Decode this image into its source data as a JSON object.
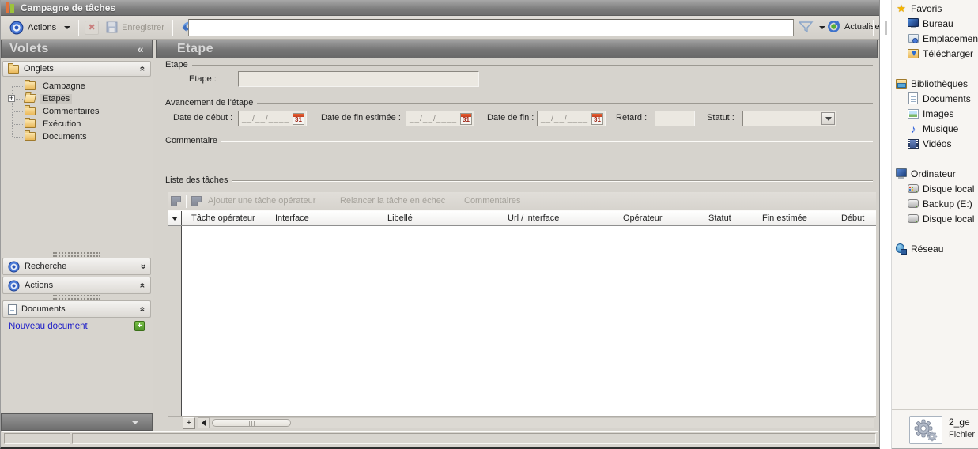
{
  "window": {
    "title": "Campagne de tâches",
    "toolbar": {
      "actions_label": "Actions",
      "save_label": "Enregistrer",
      "search_value": "",
      "refresh_label": "Actualiser"
    },
    "sidebar": {
      "panel_title": "Volets",
      "sections": {
        "onglets": "Onglets",
        "recherche": "Recherche",
        "actions": "Actions",
        "documents": "Documents"
      },
      "tree": [
        {
          "label": "Campagne"
        },
        {
          "label": "Etapes"
        },
        {
          "label": "Commentaires"
        },
        {
          "label": "Exécution"
        },
        {
          "label": "Documents"
        }
      ],
      "new_document_label": "Nouveau document"
    },
    "main": {
      "title": "Etape",
      "etape_group": {
        "legend": "Etape",
        "field_label": "Etape :",
        "value": ""
      },
      "avancement_group": {
        "legend": "Avancement de l'étape",
        "calendar_label": "31",
        "fields": [
          {
            "label": "Date de début :",
            "mask": "__/__/____"
          },
          {
            "label": "Date de fin estimée :",
            "mask": "__/__/____"
          },
          {
            "label": "Date de fin :",
            "mask": "__/__/____"
          },
          {
            "label": "Retard :",
            "value": ""
          },
          {
            "label": "Statut :",
            "value": ""
          }
        ]
      },
      "commentaire_group": {
        "legend": "Commentaire"
      },
      "tasks_group": {
        "legend": "Liste des tâches",
        "toolbar": [
          "Ajouter une tâche opérateur",
          "Relancer la tâche en échec",
          "Commentaires"
        ],
        "columns": [
          "Tâche opérateur",
          "Interface",
          "Libellé",
          "Url / interface",
          "Opérateur",
          "Statut",
          "Fin estimée",
          "Début"
        ],
        "rows": [],
        "add_row_label": "+"
      }
    }
  },
  "explorer": {
    "sections": [
      {
        "label": "Favoris",
        "icon": "star-icon",
        "items": [
          {
            "label": "Bureau",
            "icon": "desktop-icon"
          },
          {
            "label": "Emplacemen",
            "icon": "recent-places-icon"
          },
          {
            "label": "Télécharger",
            "icon": "downloads-icon"
          }
        ]
      },
      {
        "label": "Bibliothèques",
        "icon": "libraries-icon",
        "items": [
          {
            "label": "Documents",
            "icon": "document-icon"
          },
          {
            "label": "Images",
            "icon": "pictures-icon"
          },
          {
            "label": "Musique",
            "icon": "music-icon"
          },
          {
            "label": "Vidéos",
            "icon": "videos-icon"
          }
        ]
      },
      {
        "label": "Ordinateur",
        "icon": "computer-icon",
        "items": [
          {
            "label": "Disque local",
            "icon": "system-drive-icon"
          },
          {
            "label": "Backup (E:)",
            "icon": "drive-icon"
          },
          {
            "label": "Disque local",
            "icon": "drive-icon"
          }
        ]
      },
      {
        "label": "Réseau",
        "icon": "network-icon",
        "items": []
      }
    ],
    "details": {
      "file_name": "2_ge",
      "file_type": "Fichier"
    }
  },
  "icons": {
    "actions-target-icon": "concentric blue circles",
    "delete-icon": "✖",
    "save-icon": "floppy",
    "sync-icon": "⇄ blue arrows",
    "filter-icon": "funnel outline",
    "refresh-icon": "blue ring, green dot",
    "collapse-panel-icon": "«",
    "chevron-up-icon": "« rotated 90°",
    "chevron-down-icon": "« rotated -90°",
    "folder-icon": "amber folder",
    "expand-plus-icon": "+",
    "calendar-icon": "31",
    "row-filter-icon": "▼",
    "scroll-left-icon": "◄",
    "add-icon": "+",
    "star-icon": "★",
    "music-icon": "♪",
    "gears-file-icon": "two gears"
  },
  "colors": {
    "link_blue": "#1a1ac8",
    "disabled_text": "#9b978f",
    "accent_blue": "#3d6fc0",
    "selection_gray": "#c9c6c0",
    "folder_amber": "#eab95a"
  }
}
